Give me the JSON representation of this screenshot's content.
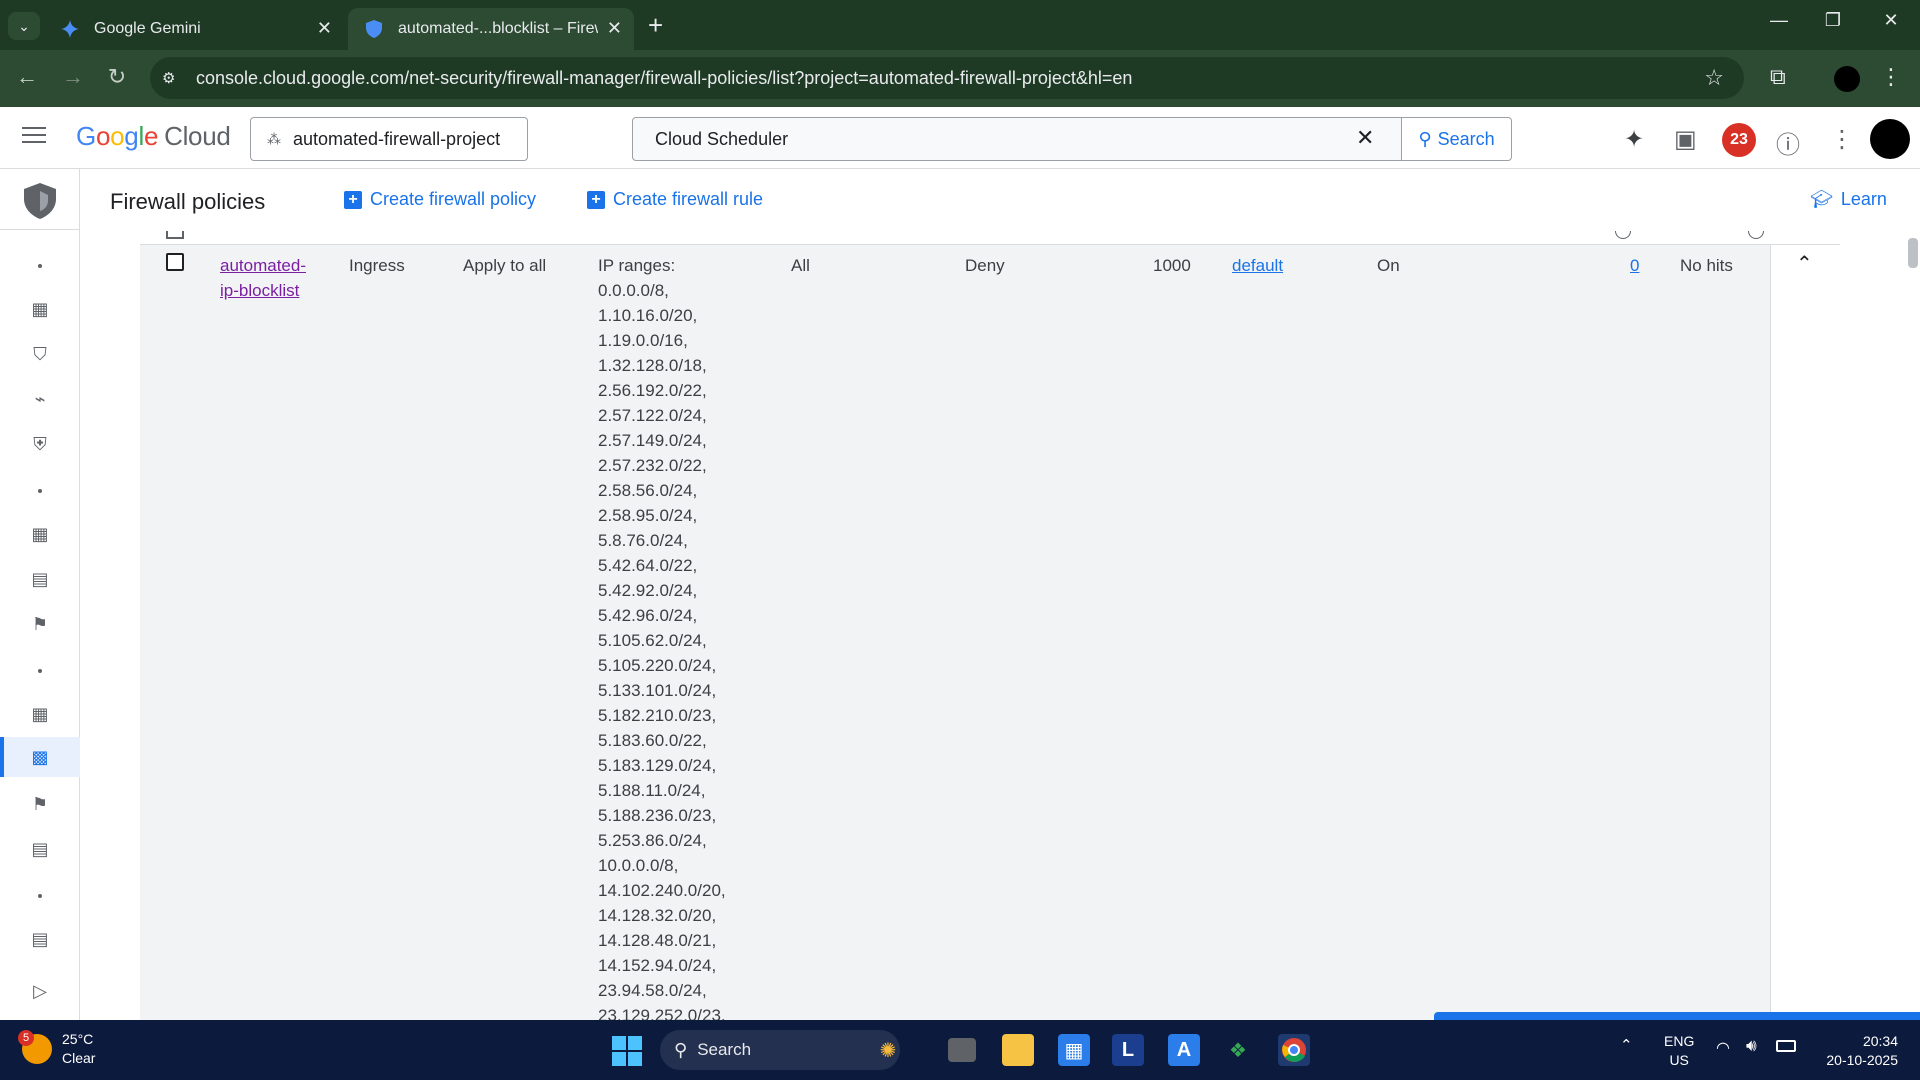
{
  "browser": {
    "tabs": [
      {
        "title": "Google Gemini",
        "icon": "gemini-icon"
      },
      {
        "title": "automated-...blocklist – Firewall",
        "icon": "shield-icon"
      }
    ],
    "url": "console.cloud.google.com/net-security/firewall-manager/firewall-policies/list?project=automated-firewall-project&hl=en"
  },
  "header": {
    "logo_google": [
      "G",
      "o",
      "o",
      "g",
      "l",
      "e"
    ],
    "logo_cloud": "Cloud",
    "project": "automated-firewall-project",
    "search_value": "Cloud Scheduler",
    "search_button": "Search",
    "notification_count": "23"
  },
  "page": {
    "title": "Firewall policies",
    "create_policy": "Create firewall policy",
    "create_rule": "Create firewall rule",
    "learn": "Learn"
  },
  "rule_row": {
    "name": "automated-ip-blocklist",
    "name_line1": "automated-",
    "name_line2": "ip-blocklist",
    "type": "Ingress",
    "targets": "Apply to all",
    "filters_label": "IP ranges:",
    "ip_ranges": [
      "0.0.0.0/8,",
      "1.10.16.0/20,",
      "1.19.0.0/16,",
      "1.32.128.0/18,",
      "2.56.192.0/22,",
      "2.57.122.0/24,",
      "2.57.149.0/24,",
      "2.57.232.0/22,",
      "2.58.56.0/24,",
      "2.58.95.0/24,",
      "5.8.76.0/24,",
      "5.42.64.0/22,",
      "5.42.92.0/24,",
      "5.42.96.0/24,",
      "5.105.62.0/24,",
      "5.105.220.0/24,",
      "5.133.101.0/24,",
      "5.182.210.0/23,",
      "5.183.60.0/22,",
      "5.183.129.0/24,",
      "5.188.11.0/24,",
      "5.188.236.0/23,",
      "5.253.86.0/24,",
      "10.0.0.0/8,",
      "14.102.240.0/20,",
      "14.128.32.0/20,",
      "14.128.48.0/21,",
      "14.152.94.0/24,",
      "23.94.58.0/24,",
      "23.129.252.0/23,"
    ],
    "protocols": "All",
    "action": "Deny",
    "priority": "1000",
    "network": "default",
    "logs": "On",
    "hit_count": "0",
    "last_hit": "No hits"
  },
  "taskbar": {
    "weather_badge": "5",
    "temperature": "25°C",
    "condition": "Clear",
    "search": "Search",
    "lang1": "ENG",
    "lang2": "US",
    "time": "20:34",
    "date": "20-10-2025"
  }
}
